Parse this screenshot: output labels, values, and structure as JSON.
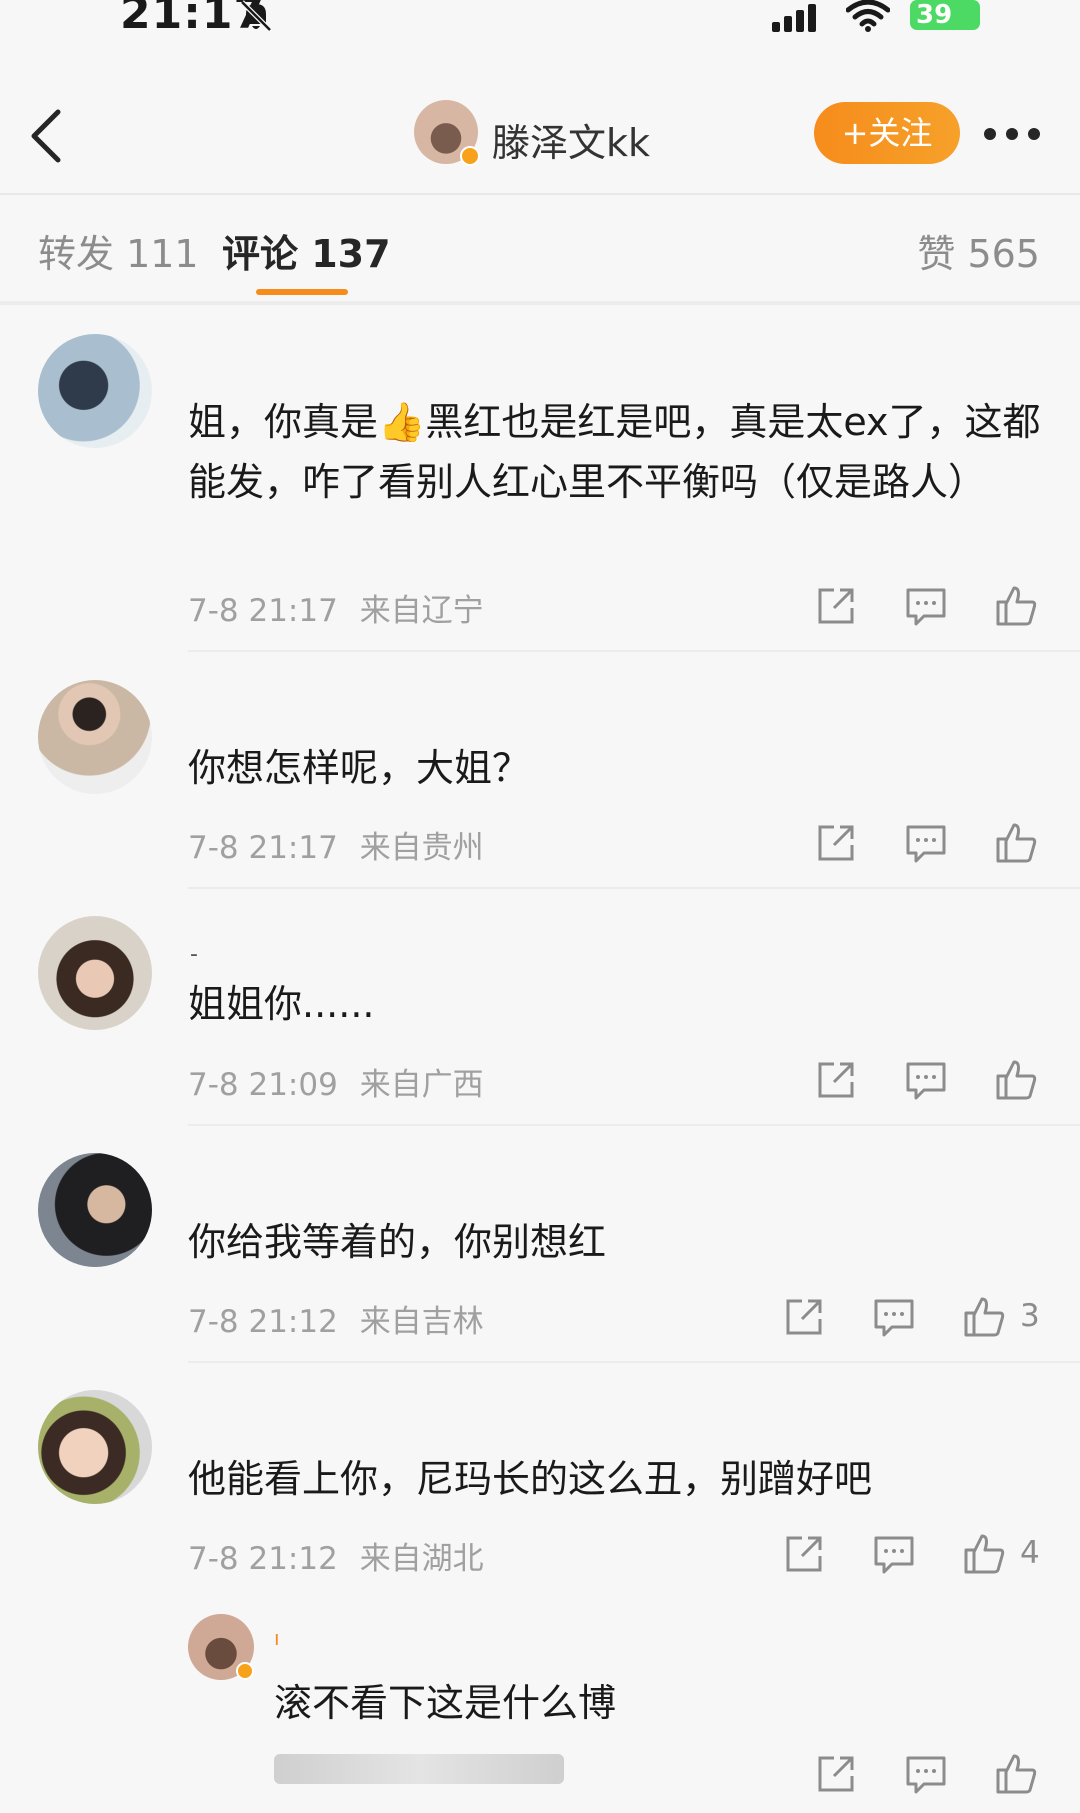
{
  "status_bar": {
    "time": "21:17",
    "battery": "39"
  },
  "header": {
    "name": "滕泽文kk",
    "follow_label": "+关注"
  },
  "tabs": [
    {
      "label": "转发 111"
    },
    {
      "label": "评论 137"
    },
    {
      "label": "赞 565"
    }
  ],
  "comments": [
    {
      "text": "姐，你真是👍黑红也是红是吧，真是太ex了，这都能发，咋了看别人红心里不平衡吗（仅是路人）",
      "time": "7-8 21:17",
      "location": "来自辽宁",
      "likes": ""
    },
    {
      "text": "你想怎样呢，大姐？",
      "time": "7-8 21:17",
      "location": "来自贵州",
      "likes": ""
    },
    {
      "text": "姐姐你......",
      "time": "7-8 21:09",
      "location": "来自广西",
      "likes": ""
    },
    {
      "text": "你给我等着的，你别想红",
      "time": "7-8 21:12",
      "location": "来自吉林",
      "likes": "3"
    },
    {
      "text": "他能看上你，尼玛长的这么丑，别蹭好吧",
      "time": "7-8 21:12",
      "location": "来自湖北",
      "likes": "4"
    }
  ],
  "reply": {
    "text": "滚不看下这是什么博"
  },
  "icons": [
    "bell-slash-icon",
    "signal-icon",
    "wifi-icon",
    "back-icon",
    "more-icon",
    "share-icon",
    "comment-icon",
    "like-icon"
  ],
  "colors": {
    "accent": "#f68c1c",
    "meta": "#a0a0a0",
    "background": "#f7f7f7"
  }
}
